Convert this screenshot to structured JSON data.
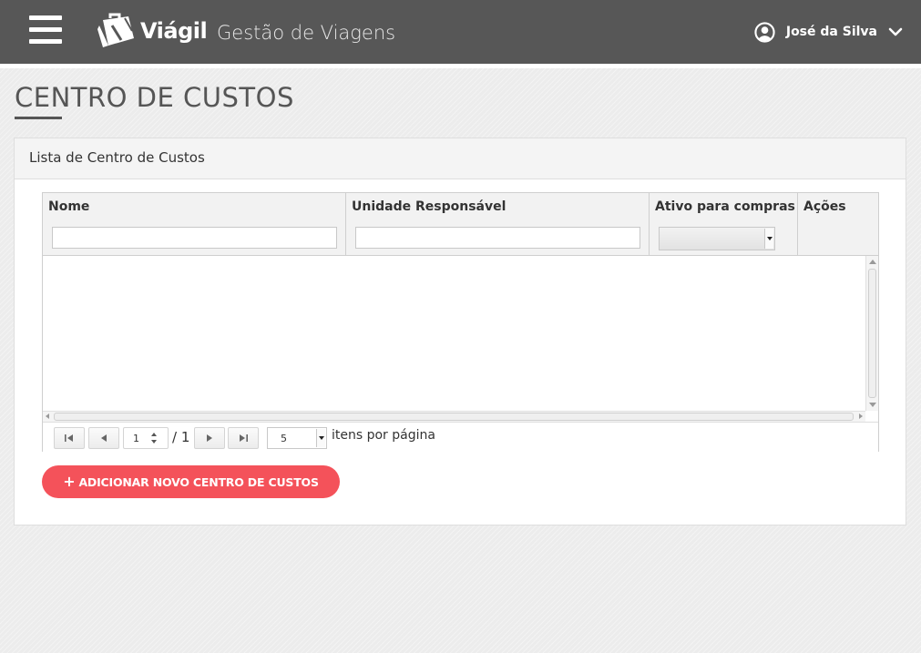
{
  "header": {
    "brand": "Viágil",
    "app_title": "Gestão de Viagens",
    "user_name": "José da Silva"
  },
  "page": {
    "title": "CENTRO DE CUSTOS"
  },
  "panel": {
    "heading": "Lista de Centro de Custos"
  },
  "grid": {
    "columns": [
      {
        "label": "Nome"
      },
      {
        "label": "Unidade Responsável"
      },
      {
        "label": "Ativo para compras"
      },
      {
        "label": "Ações"
      }
    ],
    "filters": {
      "nome_value": "",
      "unidade_value": "",
      "ativo_value": ""
    },
    "rows": []
  },
  "pager": {
    "current_page": "1",
    "total_pages": "/ 1",
    "page_size": "5",
    "items_per_page_label": "itens por página"
  },
  "actions": {
    "add_icon": "+",
    "add_label": "ADICIONAR NOVO CENTRO DE CUSTOS"
  },
  "colors": {
    "header_bg": "#575757",
    "accent": "#f4525a",
    "page_bg": "#ececec"
  },
  "icons": [
    "menu-icon",
    "viagil-logo",
    "user-avatar-icon",
    "chevron-down-icon",
    "first-page-icon",
    "prev-page-icon",
    "next-page-icon",
    "last-page-icon",
    "plus-icon"
  ]
}
